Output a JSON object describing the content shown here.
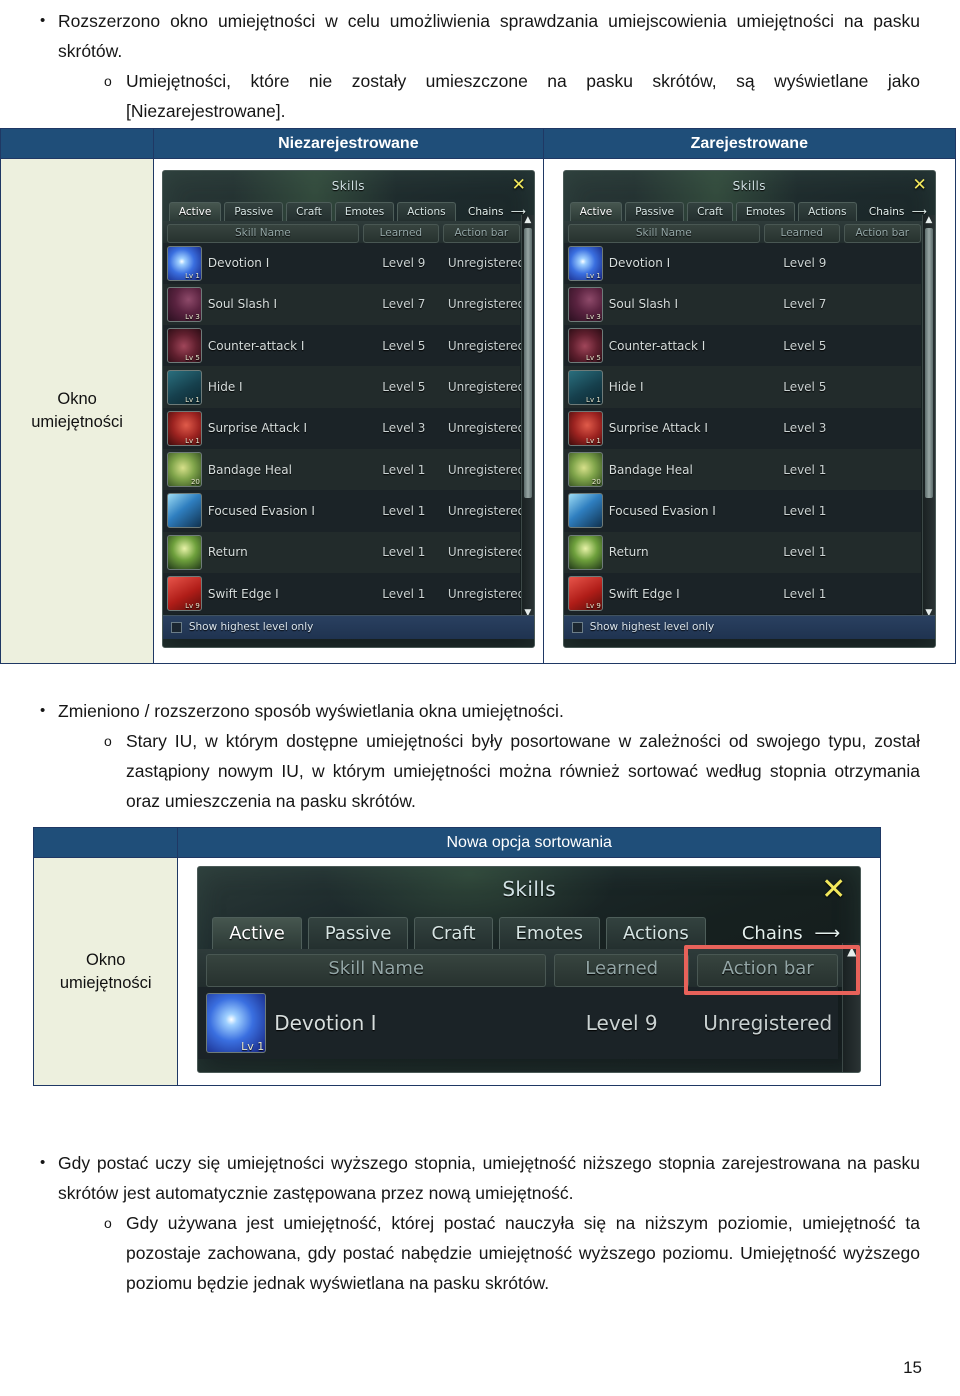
{
  "document": {
    "page_number": "15",
    "paragraphs": {
      "p1": "Rozszerzono okno umiejętności w celu umożliwienia sprawdzania umiejscowienia umiejętności na pasku skrótów.",
      "p1_sub": "Umiejętności, które nie zostały umieszczone na pasku skrótów, są wyświetlane jako [Niezarejestrowane].",
      "p2": "Zmieniono / rozszerzono sposób wyświetlania okna umiejętności.",
      "p2_sub": "Stary IU, w którym dostępne umiejętności były posortowane w zależności od swojego typu, został zastąpiony nowym IU, w którym umiejętności można również sortować według stopnia otrzymania oraz umieszczenia na pasku skrótów.",
      "p3": "Gdy postać uczy się umiejętności wyższego stopnia, umiejętność niższego stopnia zarejestrowana na pasku skrótów jest automatycznie zastępowana przez nową umiejętność.",
      "p3_sub": "Gdy używana jest umiejętność, której postać nauczyła się na niższym poziomie, umiejętność ta pozostaje zachowana, gdy postać nabędzie umiejętność wyższego poziomu. Umiejętność wyższego poziomu będzie jednak wyświetlana na pasku skrótów."
    }
  },
  "table1": {
    "header_blank": "",
    "header_left": "Niezarejestrowane",
    "header_right": "Zarejestrowane",
    "row_label": "Okno umiejętności"
  },
  "table2": {
    "header_blank": "",
    "header_main": "Nowa opcja sortowania",
    "row_label": "Okno umiejętności"
  },
  "skills_window": {
    "title": "Skills",
    "close_icon": "close-icon",
    "tabs": [
      {
        "label": "Active",
        "active": true
      },
      {
        "label": "Passive",
        "active": false
      },
      {
        "label": "Craft",
        "active": false
      },
      {
        "label": "Emotes",
        "active": false
      },
      {
        "label": "Actions",
        "active": false
      }
    ],
    "chains_label": "Chains",
    "chains_arrow_icon": "arrow-right-icon",
    "columns": {
      "skill_name": "Skill Name",
      "learned": "Learned",
      "action_bar": "Action bar"
    },
    "scroll_up_icon": "triangle-up-icon",
    "scroll_down_icon": "triangle-down-icon",
    "footer_checkbox_label": "Show highest level only",
    "unregistered_text": "Unregistered",
    "rows": [
      {
        "name": "Devotion I",
        "learned": "Level 9",
        "action_bar": "Unregistered",
        "icon": "ic-blue",
        "badge": "Lv 1"
      },
      {
        "name": "Soul Slash I",
        "learned": "Level 7",
        "action_bar": "Unregistered",
        "icon": "ic-maroon",
        "badge": "Lv 3"
      },
      {
        "name": "Counter-attack I",
        "learned": "Level 5",
        "action_bar": "Unregistered",
        "icon": "ic-darkred",
        "badge": "Lv 5"
      },
      {
        "name": "Hide I",
        "learned": "Level 5",
        "action_bar": "Unregistered",
        "icon": "ic-teal",
        "badge": "Lv 1"
      },
      {
        "name": "Surprise Attack I",
        "learned": "Level 3",
        "action_bar": "Unregistered",
        "icon": "ic-red",
        "badge": "Lv 1"
      },
      {
        "name": "Bandage Heal",
        "learned": "Level 1",
        "action_bar": "Unregistered",
        "icon": "ic-green",
        "badge": "20"
      },
      {
        "name": "Focused Evasion I",
        "learned": "Level 1",
        "action_bar": "Unregistered",
        "icon": "ic-blue2",
        "badge": ""
      },
      {
        "name": "Return",
        "learned": "Level 1",
        "action_bar": "Unregistered",
        "icon": "ic-green2",
        "badge": ""
      },
      {
        "name": "Swift Edge I",
        "learned": "Level 1",
        "action_bar": "Unregistered",
        "icon": "ic-red2",
        "badge": "Lv 9"
      }
    ]
  },
  "skills_window_registered": {
    "note": "right panel: Action bar column empty"
  },
  "skills_window_large": {
    "row": {
      "name": "Devotion I",
      "learned": "Level 9",
      "action_bar": "Unregistered",
      "icon": "ic-blue",
      "badge": "Lv 1"
    },
    "highlight": "action-bar-column"
  },
  "colors": {
    "table_header_bg": "#1f4e79",
    "table_border": "#1f3864",
    "label_cell_bg": "#edf0de",
    "highlight_red": "#e8625a",
    "close_yellow": "#f2e85c"
  }
}
